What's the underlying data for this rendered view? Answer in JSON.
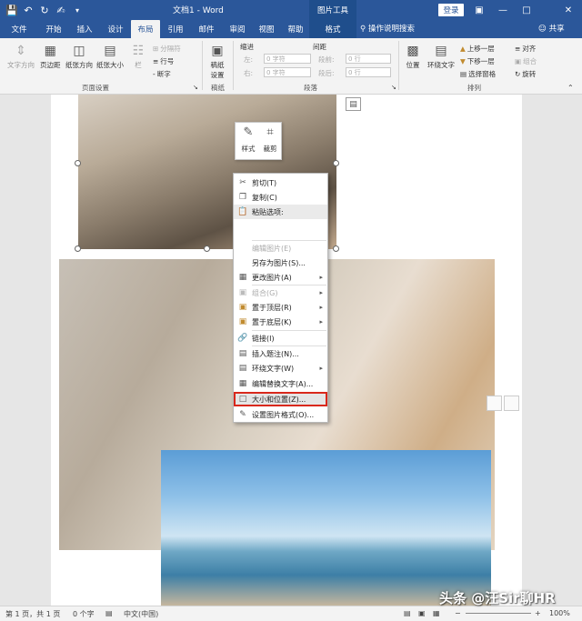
{
  "titlebar": {
    "doc_title": "文档1 - Word",
    "tools_label": "图片工具",
    "login": "登录",
    "save_icon": "save-icon",
    "undo_icon": "undo-icon",
    "redo_icon": "redo-icon",
    "touch_icon": "touch-mode-icon"
  },
  "tabs": [
    {
      "label": "文件"
    },
    {
      "label": "开始"
    },
    {
      "label": "插入"
    },
    {
      "label": "设计"
    },
    {
      "label": "布局"
    },
    {
      "label": "引用"
    },
    {
      "label": "邮件"
    },
    {
      "label": "审阅"
    },
    {
      "label": "视图"
    },
    {
      "label": "帮助"
    },
    {
      "label": "格式"
    }
  ],
  "tell_me": "操作说明搜索",
  "share": "共享",
  "ribbon": {
    "text_direction": "文字方向",
    "margins": "页边距",
    "orientation": "纸张方向",
    "size": "纸张大小",
    "columns": "栏",
    "breaks": "分隔符",
    "line_numbers": "行号",
    "hyphenation": "断字",
    "page_setup_group": "页面设置",
    "draft_paper": "稿纸设置",
    "draft_group": "稿纸",
    "indent": "缩进",
    "indent_left_label": "左:",
    "indent_left_value": "0 字符",
    "indent_right_label": "右:",
    "indent_right_value": "0 字符",
    "spacing": "间距",
    "spacing_before_label": "段前:",
    "spacing_before_value": "0 行",
    "spacing_after_label": "段后:",
    "spacing_after_value": "0 行",
    "paragraph_group": "段落",
    "position": "位置",
    "wrap_text": "环绕文字",
    "bring_forward": "上移一层",
    "send_backward": "下移一层",
    "selection_pane": "选择窗格",
    "align": "对齐",
    "group": "组合",
    "rotate": "旋转",
    "arrange_group": "排列"
  },
  "mini_toolbar": {
    "style": "样式",
    "crop": "裁剪"
  },
  "context_menu": {
    "cut": "剪切(T)",
    "copy": "复制(C)",
    "paste_options": "粘贴选项:",
    "edit_picture": "编辑图片(E)",
    "save_as_picture": "另存为图片(S)...",
    "change_picture": "更改图片(A)",
    "group": "组合(G)",
    "bring_to_front": "置于顶层(R)",
    "send_to_back": "置于底层(K)",
    "link": "链接(I)",
    "insert_caption": "插入题注(N)...",
    "wrap_text": "环绕文字(W)",
    "edit_alt_text": "编辑替换文字(A)...",
    "size_and_position": "大小和位置(Z)...",
    "format_picture": "设置图片格式(O)..."
  },
  "statusbar": {
    "page": "第 1 页，共 1 页",
    "words": "0 个字",
    "language": "中文(中国)",
    "zoom": "100%"
  },
  "watermark": "头条 @汪Sir聊HR",
  "colors": {
    "accent": "#2b579a",
    "highlight_border": "#d9281c"
  }
}
